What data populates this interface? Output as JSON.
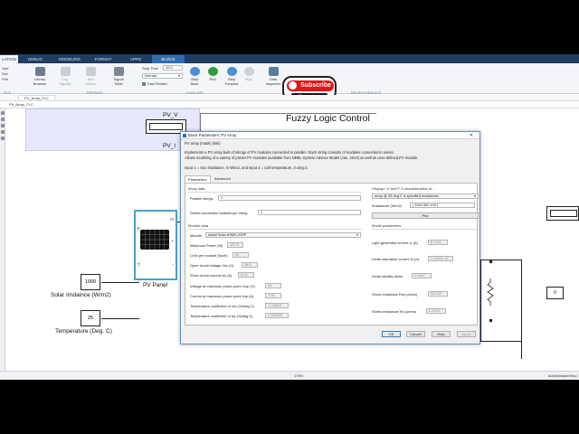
{
  "ribbon": {
    "tabs": [
      "LATION",
      "DEBUG",
      "MODELING",
      "FORMAT",
      "APPS",
      "BLOCK"
    ],
    "library_browser": "Library\nBrowser",
    "log_signals": "Log\nSignals",
    "add_viewer": "Add\nViewer",
    "signal_table": "Signal\nTable",
    "stop_time_label": "Stop Time",
    "stop_time_value": "10.0",
    "mode_value": "Normal",
    "fast_restart": "Fast Restart",
    "step_back": "Step\nBack",
    "run": "Run",
    "step_forward": "Step\nForward",
    "stop": "Stop",
    "data_inspector": "Data\nInspector",
    "left_items": [
      "Ope",
      "Sav",
      "Prin"
    ],
    "groups": [
      "FILE",
      "PREPARE",
      "SIMULATE",
      "REVIEW RESULTS"
    ],
    "subscribe_text": "Subscribe",
    "subscribe_sub": "like & share"
  },
  "breadcrumbs": {
    "top": "PV_Array_FLC",
    "second": "PV_Array_FLC"
  },
  "canvas": {
    "block_pv_v": "PV_V",
    "block_pv_i": "PV_I",
    "title": "Fuzzy Logic Control",
    "irradiance_value": "1000",
    "irradiance_label": "Solar Irridaince (W/m2)",
    "temperature_value": "25",
    "temperature_label": "Temperature (Deg. C)",
    "pv_panel_label": "PV Panel",
    "port_ir": "Ir",
    "port_t": "T",
    "port_m": "m",
    "port_plus": "+",
    "port_minus": "-"
  },
  "status": {
    "zoom": "175%",
    "solver": "auto(VariableStep"
  },
  "dialog": {
    "title": "Block Parameters: PV Array",
    "block_type": "PV array (mask) (link)",
    "desc1": "Implements a PV array built of strings of PV modules connected in parallel. Each string consists of modules connected in series.",
    "desc2": "Allows modeling of a variety of preset PV modules available from NREL System Advisor Model (Jan. 2014) as well as user-defined PV module.",
    "desc3": "Input 1 = Sun irradiance, in W/m2, and input 2 = Cell temperature, in deg.C.",
    "tab_parameters": "Parameters",
    "tab_advanced": "Advanced",
    "array_data": "Array data",
    "parallel_strings_label": "Parallel strings",
    "parallel_strings_value": "1",
    "series_modules_label": "Series-connected modules per string",
    "series_modules_value": "1",
    "display_label": "Display I-V and P-V characteristics of ...",
    "display_value": "array @ 25 deg.C & specified irradiances",
    "irradiances_label": "Irradiances (W/m2)",
    "irradiances_value": "[ 1000  500  100 ]",
    "plot_button": "Plot",
    "module_data": "Module data",
    "module_label": "Module:",
    "module_value": "Aavid Solar ASMS-220P",
    "model_parameters": "Model parameters",
    "left_params": [
      {
        "label": "Maximum Power (W)",
        "value": "220.5"
      },
      {
        "label": "Cells per module (Ncell)",
        "value": "60"
      },
      {
        "label": "Open circuit voltage  Voc (V)",
        "value": "36.6"
      },
      {
        "label": "Short-circuit current Isc (A)",
        "value": "8.06"
      },
      {
        "label": "Voltage at maximum power point Vmp (V)",
        "value": "30"
      },
      {
        "label": "Current at maximum power point Imp (A)",
        "value": "7.35"
      },
      {
        "label": "Temperature coefficient of Voc (%/deg.C)",
        "value": "-0.33644"
      },
      {
        "label": "Temperature coefficient of Isc (%/deg.C)",
        "value": "0.035405"
      }
    ],
    "right_params": [
      {
        "label": "Light-generated current IL (A)",
        "value": "8.1106"
      },
      {
        "label": "Diode saturation current I0 (A)",
        "value": "1.1169e-10"
      },
      {
        "label": "Diode ideality factor",
        "value": "0.9367"
      },
      {
        "label": "Shunt resistance Rsh (ohms)",
        "value": "92.009"
      },
      {
        "label": "Series resistance Rs (ohms)",
        "value": "0.3492"
      }
    ],
    "ok": "OK",
    "cancel": "Cancel",
    "help": "Help",
    "apply": "Apply"
  }
}
